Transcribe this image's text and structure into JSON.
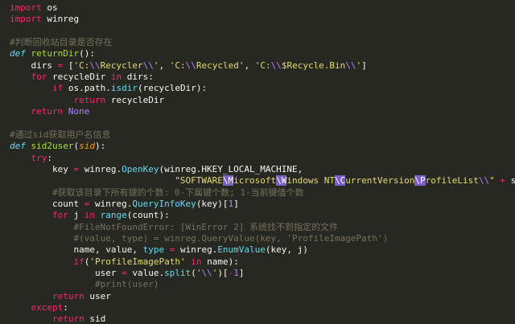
{
  "editor": {
    "background": "#272822",
    "colors": {
      "keyword": "#f92672",
      "definition": "#66d9ef",
      "function": "#a6e22e",
      "string": "#e6db74",
      "comment": "#75715e",
      "builtin": "#66d9ef",
      "parameter": "#fd971f",
      "number": "#ae81ff",
      "escape_highlight": "#7b5fc7",
      "plain": "#f8f8f2"
    },
    "lines": [
      [
        {
          "c": "kw",
          "t": "import"
        },
        {
          "c": "pl",
          "t": " os"
        }
      ],
      [
        {
          "c": "kw",
          "t": "import"
        },
        {
          "c": "pl",
          "t": " winreg"
        }
      ],
      [],
      [
        {
          "c": "cm",
          "t": "#判断回收站目录是否存在"
        }
      ],
      [
        {
          "c": "def",
          "t": "def"
        },
        {
          "c": "pl",
          "t": " "
        },
        {
          "c": "fn",
          "t": "returnDir"
        },
        {
          "c": "pl",
          "t": "():"
        }
      ],
      [
        {
          "c": "pl",
          "t": "    dirs "
        },
        {
          "c": "kw",
          "t": "="
        },
        {
          "c": "pl",
          "t": " ["
        },
        {
          "c": "str",
          "t": "'C:"
        },
        {
          "c": "num",
          "t": "\\\\"
        },
        {
          "c": "str",
          "t": "Recycler"
        },
        {
          "c": "num",
          "t": "\\\\"
        },
        {
          "c": "str",
          "t": "'"
        },
        {
          "c": "pl",
          "t": ", "
        },
        {
          "c": "str",
          "t": "'C:"
        },
        {
          "c": "num",
          "t": "\\\\"
        },
        {
          "c": "str",
          "t": "Recycled'"
        },
        {
          "c": "pl",
          "t": ", "
        },
        {
          "c": "str",
          "t": "'C:"
        },
        {
          "c": "num",
          "t": "\\\\"
        },
        {
          "c": "str",
          "t": "$Recycle.Bin"
        },
        {
          "c": "num",
          "t": "\\\\"
        },
        {
          "c": "str",
          "t": "'"
        },
        {
          "c": "pl",
          "t": "]"
        }
      ],
      [
        {
          "c": "pl",
          "t": "    "
        },
        {
          "c": "kw",
          "t": "for"
        },
        {
          "c": "pl",
          "t": " recycleDir "
        },
        {
          "c": "kw",
          "t": "in"
        },
        {
          "c": "pl",
          "t": " dirs:"
        }
      ],
      [
        {
          "c": "pl",
          "t": "        "
        },
        {
          "c": "kw",
          "t": "if"
        },
        {
          "c": "pl",
          "t": " os.path."
        },
        {
          "c": "bi",
          "t": "isdir"
        },
        {
          "c": "pl",
          "t": "(recycleDir):"
        }
      ],
      [
        {
          "c": "pl",
          "t": "            "
        },
        {
          "c": "kw",
          "t": "return"
        },
        {
          "c": "pl",
          "t": " recycleDir"
        }
      ],
      [
        {
          "c": "pl",
          "t": "    "
        },
        {
          "c": "kw",
          "t": "return"
        },
        {
          "c": "pl",
          "t": " "
        },
        {
          "c": "num",
          "t": "None"
        }
      ],
      [],
      [
        {
          "c": "cm",
          "t": "#通过sid获取用户名信息"
        }
      ],
      [
        {
          "c": "def",
          "t": "def"
        },
        {
          "c": "pl",
          "t": " "
        },
        {
          "c": "fn",
          "t": "sid2user"
        },
        {
          "c": "pl",
          "t": "("
        },
        {
          "c": "param",
          "t": "sid"
        },
        {
          "c": "pl",
          "t": "):"
        }
      ],
      [
        {
          "c": "pl",
          "t": "    "
        },
        {
          "c": "kw",
          "t": "try"
        },
        {
          "c": "pl",
          "t": ":"
        }
      ],
      [
        {
          "c": "pl",
          "t": "        key "
        },
        {
          "c": "kw",
          "t": "="
        },
        {
          "c": "pl",
          "t": " winreg."
        },
        {
          "c": "bi",
          "t": "OpenKey"
        },
        {
          "c": "pl",
          "t": "(winreg.HKEY_LOCAL_MACHINE,"
        }
      ],
      [
        {
          "c": "pl",
          "t": "                               "
        },
        {
          "c": "str",
          "t": "\"SOFTWARE"
        },
        {
          "c": "esc",
          "t": "\\M"
        },
        {
          "c": "str",
          "t": "icrosoft"
        },
        {
          "c": "esc",
          "t": "\\W"
        },
        {
          "c": "str",
          "t": "indows NT"
        },
        {
          "c": "esc",
          "t": "\\C"
        },
        {
          "c": "str",
          "t": "urrentVersion"
        },
        {
          "c": "esc",
          "t": "\\P"
        },
        {
          "c": "str",
          "t": "rofileList"
        },
        {
          "c": "num",
          "t": "\\\\"
        },
        {
          "c": "str",
          "t": "\""
        },
        {
          "c": "pl",
          "t": " "
        },
        {
          "c": "kw",
          "t": "+"
        },
        {
          "c": "pl",
          "t": " sid)"
        }
      ],
      [
        {
          "c": "pl",
          "t": "        "
        },
        {
          "c": "cm",
          "t": "#获取该目录下所有键的个数: 0-下属键个数; 1-当前键值个数"
        }
      ],
      [
        {
          "c": "pl",
          "t": "        count "
        },
        {
          "c": "kw",
          "t": "="
        },
        {
          "c": "pl",
          "t": " winreg."
        },
        {
          "c": "bi",
          "t": "QueryInfoKey"
        },
        {
          "c": "pl",
          "t": "(key)["
        },
        {
          "c": "num",
          "t": "1"
        },
        {
          "c": "pl",
          "t": "]"
        }
      ],
      [
        {
          "c": "pl",
          "t": "        "
        },
        {
          "c": "kw",
          "t": "for"
        },
        {
          "c": "pl",
          "t": " j "
        },
        {
          "c": "kw",
          "t": "in"
        },
        {
          "c": "pl",
          "t": " "
        },
        {
          "c": "bi",
          "t": "range"
        },
        {
          "c": "pl",
          "t": "(count):"
        }
      ],
      [
        {
          "c": "pl",
          "t": "            "
        },
        {
          "c": "cm",
          "t": "#FileNotFoundError: [WinError 2] 系统找不到指定的文件"
        }
      ],
      [
        {
          "c": "pl",
          "t": "            "
        },
        {
          "c": "cm",
          "t": "#(value, type) = winreg.QueryValue(key, 'ProfileImagePath')"
        }
      ],
      [
        {
          "c": "pl",
          "t": "            name, value, "
        },
        {
          "c": "bi",
          "t": "type"
        },
        {
          "c": "pl",
          "t": " "
        },
        {
          "c": "kw",
          "t": "="
        },
        {
          "c": "pl",
          "t": " winreg."
        },
        {
          "c": "bi",
          "t": "EnumValue"
        },
        {
          "c": "pl",
          "t": "(key, j)"
        }
      ],
      [
        {
          "c": "pl",
          "t": "            "
        },
        {
          "c": "kw",
          "t": "if"
        },
        {
          "c": "pl",
          "t": "("
        },
        {
          "c": "str",
          "t": "'ProfileImagePath'"
        },
        {
          "c": "pl",
          "t": " "
        },
        {
          "c": "kw",
          "t": "in"
        },
        {
          "c": "pl",
          "t": " name):"
        }
      ],
      [
        {
          "c": "pl",
          "t": "                user "
        },
        {
          "c": "kw",
          "t": "="
        },
        {
          "c": "pl",
          "t": " value."
        },
        {
          "c": "bi",
          "t": "split"
        },
        {
          "c": "pl",
          "t": "("
        },
        {
          "c": "str",
          "t": "'"
        },
        {
          "c": "num",
          "t": "\\\\"
        },
        {
          "c": "str",
          "t": "'"
        },
        {
          "c": "pl",
          "t": ")["
        },
        {
          "c": "kw",
          "t": "-"
        },
        {
          "c": "num",
          "t": "1"
        },
        {
          "c": "pl",
          "t": "]"
        }
      ],
      [
        {
          "c": "pl",
          "t": "                "
        },
        {
          "c": "cm",
          "t": "#print(user)"
        }
      ],
      [
        {
          "c": "pl",
          "t": "        "
        },
        {
          "c": "kw",
          "t": "return"
        },
        {
          "c": "pl",
          "t": " user"
        }
      ],
      [
        {
          "c": "pl",
          "t": "    "
        },
        {
          "c": "kw",
          "t": "except"
        },
        {
          "c": "pl",
          "t": ":"
        }
      ],
      [
        {
          "c": "pl",
          "t": "        "
        },
        {
          "c": "kw",
          "t": "return"
        },
        {
          "c": "pl",
          "t": " sid"
        }
      ]
    ]
  }
}
